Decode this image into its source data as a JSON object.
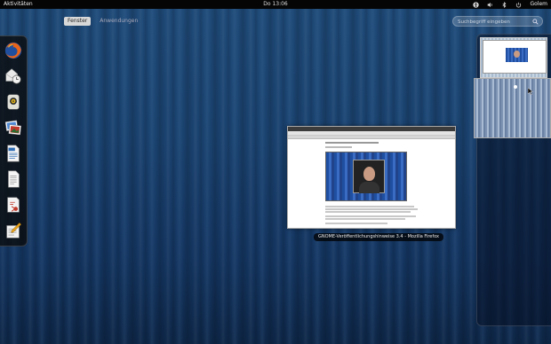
{
  "top_panel": {
    "activities_label": "Aktivitäten",
    "clock": "Do 13:06",
    "user_name": "Golem",
    "tray_icons": [
      "accessibility-icon",
      "volume-icon",
      "bluetooth-icon",
      "power-icon"
    ]
  },
  "view_selector": {
    "windows_label": "Fenster",
    "applications_label": "Anwendungen",
    "active": "Fenster"
  },
  "search": {
    "placeholder": "Suchbegriff eingeben",
    "value": ""
  },
  "dash": {
    "items": [
      {
        "name": "firefox",
        "icon": "firefox-icon"
      },
      {
        "name": "evolution",
        "icon": "mail-clock-icon"
      },
      {
        "name": "rhythmbox",
        "icon": "music-player-icon"
      },
      {
        "name": "shotwell",
        "icon": "photos-icon"
      },
      {
        "name": "writer",
        "icon": "document-writer-icon"
      },
      {
        "name": "documents",
        "icon": "text-document-icon"
      },
      {
        "name": "software",
        "icon": "package-icon"
      },
      {
        "name": "editor",
        "icon": "text-editor-icon"
      }
    ]
  },
  "window": {
    "caption": "GNOME-Veröffentlichungshinweise 3.4 - Mozilla Firefox"
  },
  "colors": {
    "panel": "#050505",
    "background": "#1a426f",
    "dash_bg": "#0a0a0a",
    "active_tab": "#d8d8d8"
  }
}
